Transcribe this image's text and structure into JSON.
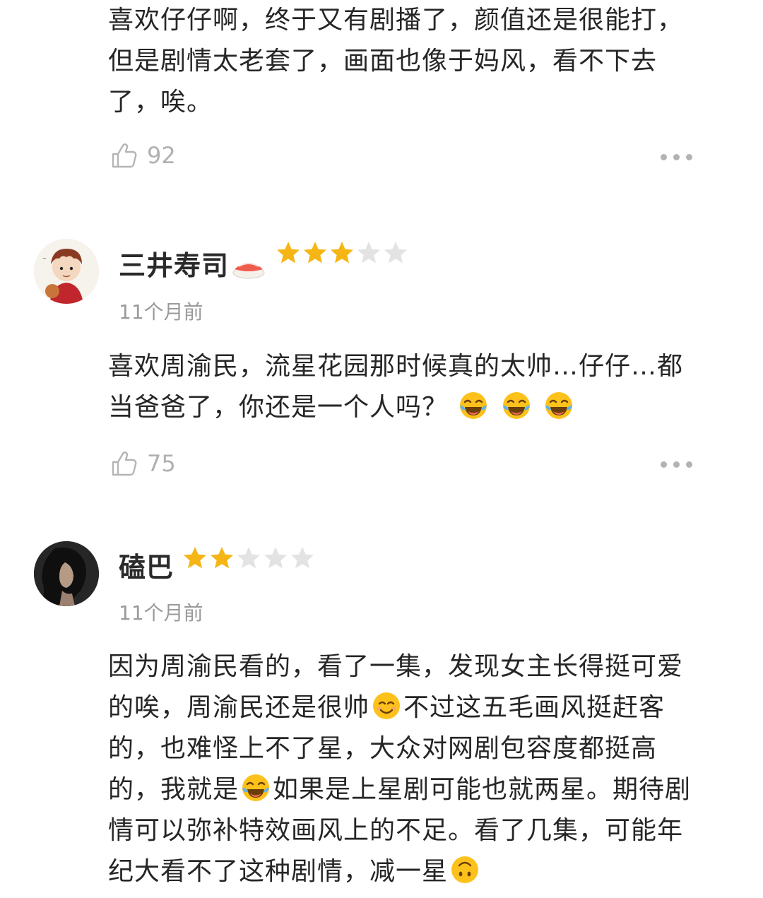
{
  "colors": {
    "star_filled": "#f5b514",
    "star_empty": "#e3e3e3",
    "muted": "#9a9a9a",
    "text": "#262626"
  },
  "comments": [
    {
      "partial": true,
      "body_lines": [
        "喜欢仔仔啊，终于又有剧播了，颜值还是很能打，",
        "但是剧情太老套了，画面也像于妈风，看不下去",
        "了，唉。"
      ],
      "likes": "92"
    },
    {
      "name": "三井寿司",
      "name_emoji": "sushi-icon",
      "rating": 3,
      "rating_max": 5,
      "time": "11个月前",
      "body_lines": [
        {
          "text": "喜欢周渝民，流星花园那时候真的太帅…仔仔…都"
        },
        {
          "text": "当爸爸了，你还是一个人吗？",
          "trailing_emojis": [
            "laughing-tears-emoji",
            "laughing-tears-emoji",
            "laughing-tears-emoji"
          ]
        }
      ],
      "likes": "75"
    },
    {
      "name": "磕巴",
      "rating": 2,
      "rating_max": 5,
      "time": "11个月前",
      "body_lines": [
        {
          "text": "因为周渝民看的，看了一集，发现女主长得挺可爱"
        },
        {
          "before": "的唉，周渝民还是很帅",
          "emoji": "smile-emoji",
          "after": "不过这五毛画风挺赶客"
        },
        {
          "text": "的，也难怪上不了星，大众对网剧包容度都挺高"
        },
        {
          "before": "的，我就是",
          "emoji": "laughing-tears-emoji",
          "after": "如果是上星剧可能也就两星。期待剧"
        },
        {
          "text": "情可以弥补特效画风上的不足。看了几集，可能年"
        },
        {
          "before": "纪大看不了这种剧情，减一星",
          "emoji": "upside-down-smile-emoji",
          "after": ""
        }
      ]
    }
  ]
}
